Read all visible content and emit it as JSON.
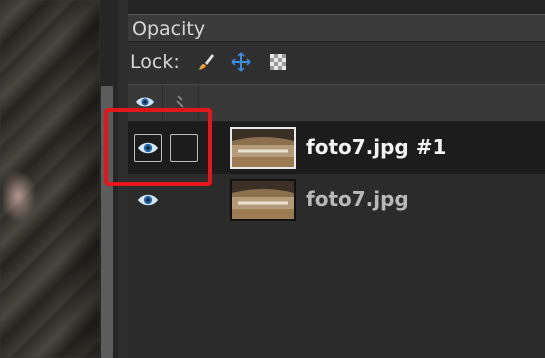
{
  "layers_panel": {
    "mode_label": "Opacity",
    "lock_label": "Lock:",
    "lock_icons": [
      "paintbrush-icon",
      "move-cross-icon",
      "checkerboard-alpha-icon"
    ],
    "header_icons": [
      "eye-icon",
      "chain-icon"
    ],
    "layers": [
      {
        "name": "foto7.jpg #1",
        "visible": true,
        "linked": false,
        "selected": true,
        "thumbnail": "image-thumbnail"
      },
      {
        "name": "foto7.jpg",
        "visible": true,
        "linked": false,
        "selected": false,
        "thumbnail": "image-thumbnail"
      }
    ]
  },
  "colors": {
    "highlight": "#e3161c",
    "lock_accent": "#3a8de0",
    "selected_text": "#f2f2f2",
    "normal_text": "#b8b8b8"
  }
}
